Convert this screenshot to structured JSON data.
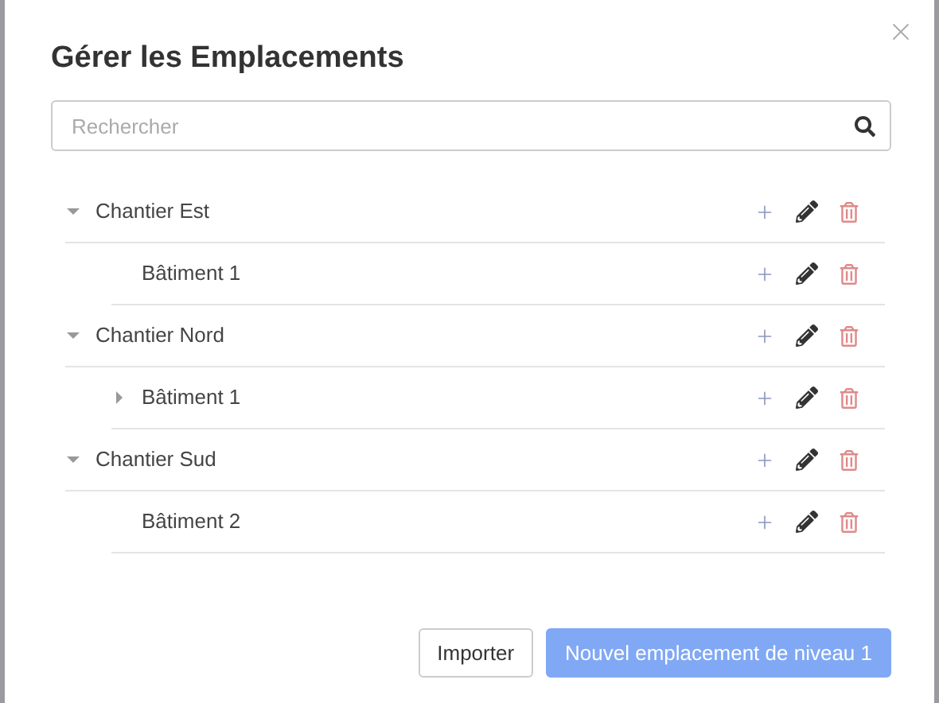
{
  "dialog": {
    "title": "Gérer les Emplacements"
  },
  "search": {
    "placeholder": "Rechercher"
  },
  "tree": [
    {
      "label": "Chantier Est",
      "expanded": true,
      "children": [
        {
          "label": "Bâtiment 1"
        }
      ]
    },
    {
      "label": "Chantier Nord",
      "expanded": true,
      "children": [
        {
          "label": "Bâtiment 1",
          "expanded": false
        }
      ]
    },
    {
      "label": "Chantier Sud",
      "expanded": true,
      "children": [
        {
          "label": "Bâtiment 2"
        }
      ]
    }
  ],
  "buttons": [
    {
      "label": "Importer",
      "kind": "secondary"
    },
    {
      "label": "Nouvel emplacement de niveau 1",
      "kind": "primary"
    }
  ]
}
